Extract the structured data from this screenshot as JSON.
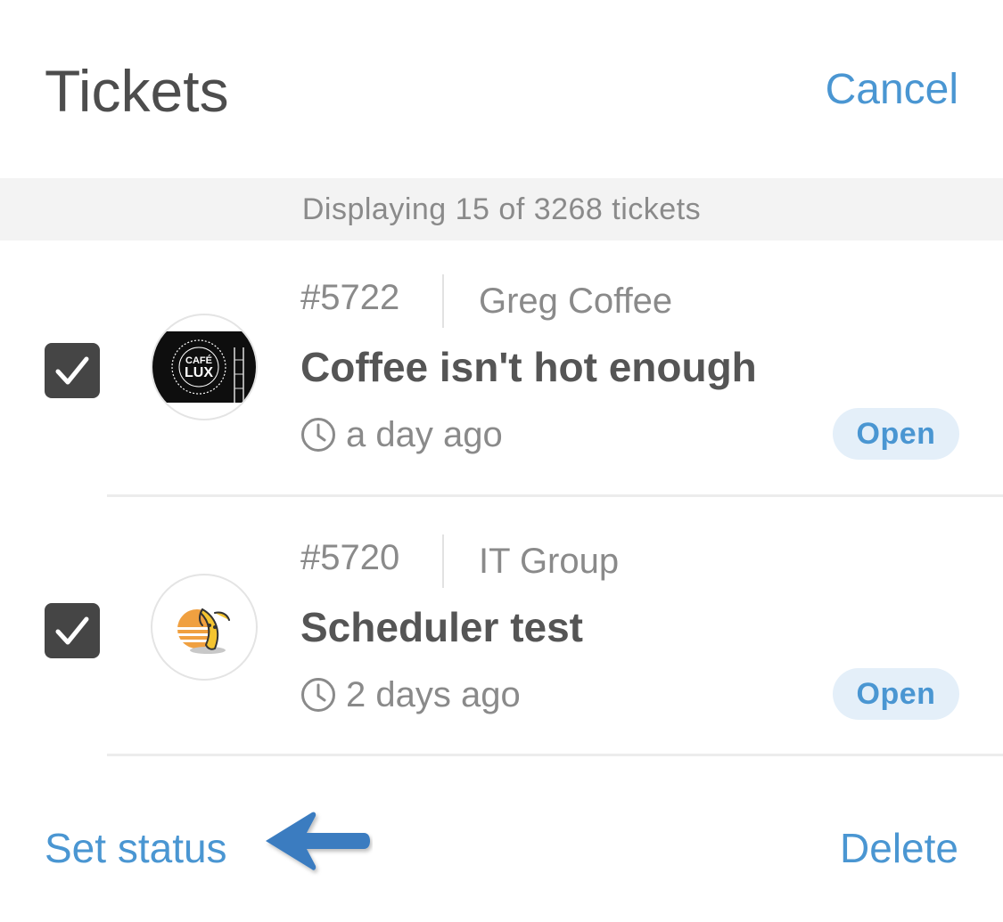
{
  "header": {
    "title": "Tickets",
    "cancel_label": "Cancel"
  },
  "summary": {
    "text": "Displaying 15 of 3268 tickets"
  },
  "tickets": [
    {
      "number": "#5722",
      "requester": "Greg Coffee",
      "subject": "Coffee isn't hot enough",
      "time": "a day ago",
      "status": "Open",
      "selected": true,
      "avatar_icon": "cafe-lux-logo",
      "avatar_text": [
        "CAFÉ",
        "LUX"
      ]
    },
    {
      "number": "#5720",
      "requester": "IT Group",
      "subject": "Scheduler test",
      "time": "2 days ago",
      "status": "Open",
      "selected": true,
      "avatar_icon": "banana-sunset-logo"
    }
  ],
  "footer": {
    "set_status_label": "Set status",
    "delete_label": "Delete",
    "annotation": "arrow-pointing-left-icon"
  },
  "colors": {
    "accent": "#4a96d2",
    "badge_bg": "#e4eff9",
    "checkbox": "#454545",
    "arrow": "#3a7cc0"
  }
}
